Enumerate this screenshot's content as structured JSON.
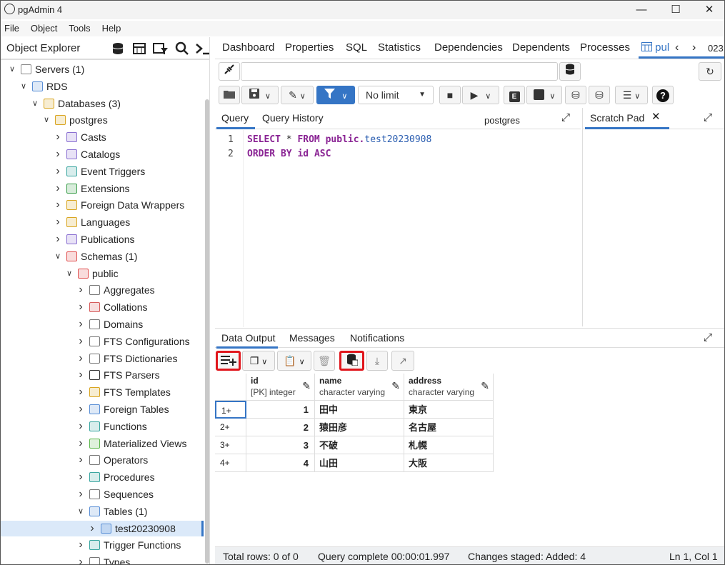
{
  "window": {
    "title": "pgAdmin 4"
  },
  "menu": [
    "File",
    "Object",
    "Tools",
    "Help"
  ],
  "left_panel": {
    "title": "Object Explorer"
  },
  "tree": [
    {
      "label": "Servers (1)",
      "expanded": true
    },
    {
      "label": "RDS",
      "expanded": true
    },
    {
      "label": "Databases (3)",
      "expanded": true
    },
    {
      "label": "postgres",
      "expanded": true
    },
    {
      "label": "Casts"
    },
    {
      "label": "Catalogs"
    },
    {
      "label": "Event Triggers"
    },
    {
      "label": "Extensions"
    },
    {
      "label": "Foreign Data Wrappers"
    },
    {
      "label": "Languages"
    },
    {
      "label": "Publications"
    },
    {
      "label": "Schemas (1)",
      "expanded": true
    },
    {
      "label": "public",
      "expanded": true
    },
    {
      "label": "Aggregates"
    },
    {
      "label": "Collations"
    },
    {
      "label": "Domains"
    },
    {
      "label": "FTS Configurations"
    },
    {
      "label": "FTS Dictionaries"
    },
    {
      "label": "FTS Parsers"
    },
    {
      "label": "FTS Templates"
    },
    {
      "label": "Foreign Tables"
    },
    {
      "label": "Functions"
    },
    {
      "label": "Materialized Views"
    },
    {
      "label": "Operators"
    },
    {
      "label": "Procedures"
    },
    {
      "label": "Sequences"
    },
    {
      "label": "Tables (1)",
      "expanded": true
    },
    {
      "label": "test20230908",
      "selected": true
    },
    {
      "label": "Trigger Functions"
    },
    {
      "label": "Types"
    }
  ],
  "tabs": [
    "Dashboard",
    "Properties",
    "SQL",
    "Statistics",
    "Dependencies",
    "Dependents",
    "Processes",
    "pul",
    "023"
  ],
  "toolbar": {
    "limit": "No limit"
  },
  "editor_tabs": {
    "query": "Query",
    "history": "Query History",
    "db": "postgres",
    "scratch": "Scratch Pad"
  },
  "sql_lines": [
    {
      "n": "1",
      "kw1": "SELECT",
      "op": " * ",
      "kw2": "FROM",
      "schema": " public.",
      "ident": "test20230908",
      "rest": ""
    },
    {
      "n": "2",
      "kw1": "ORDER BY",
      "op": " ",
      "kw2": "",
      "schema": "id ",
      "ident": "",
      "rest": "ASC"
    }
  ],
  "output_tabs": [
    "Data Output",
    "Messages",
    "Notifications"
  ],
  "columns": [
    {
      "name": "id",
      "type": "[PK] integer"
    },
    {
      "name": "name",
      "type": "character varying"
    },
    {
      "name": "address",
      "type": "character varying"
    }
  ],
  "rows": [
    {
      "rn": "1+",
      "id": "1",
      "name": "田中",
      "address": "東京"
    },
    {
      "rn": "2+",
      "id": "2",
      "name": "猿田彦",
      "address": "名古屋"
    },
    {
      "rn": "3+",
      "id": "3",
      "name": "不破",
      "address": "札幌"
    },
    {
      "rn": "4+",
      "id": "4",
      "name": "山田",
      "address": "大阪"
    }
  ],
  "status": {
    "total": "Total rows: 0 of 0",
    "query": "Query complete 00:00:01.997",
    "changes": "Changes staged: Added: 4",
    "pos": "Ln 1, Col 1"
  },
  "colors": {
    "accent": "#3575c5",
    "highlight": "#e0161c"
  }
}
